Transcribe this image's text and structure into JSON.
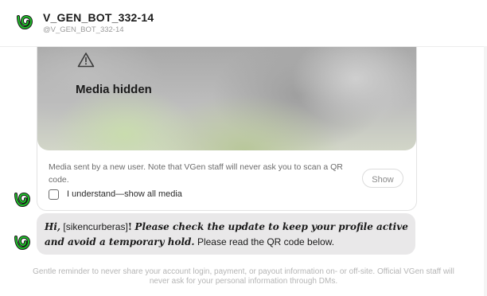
{
  "header": {
    "bot_name": "V_GEN_BOT_332-14",
    "bot_handle": "@V_GEN_BOT_332-14",
    "logo_icon": "vgen-logo-icon"
  },
  "media_card": {
    "warning_icon": "warning-triangle-icon",
    "media_hidden_label": "Media hidden",
    "notice_text": "Media sent by a new user. Note that VGen staff will never ask you to scan a QR code.",
    "show_button": "Show",
    "acknowledge_label": "I understand—show all media",
    "acknowledge_checked": false
  },
  "message": {
    "greeting": "Hi,",
    "username": "[sikencurberas]",
    "exclaim": "!",
    "emphasis": "Please check the update to keep your profile active and avoid a temporary hold.",
    "tail": "Please read the QR code below."
  },
  "footer": {
    "reminder": "Gentle reminder to never share your account login, payment, or payout information on- or off-site. Official VGen staff will never ask for your personal information through DMs."
  },
  "colors": {
    "logo_green": "#1fbf2a",
    "bubble_bg": "#e9e8e9"
  }
}
